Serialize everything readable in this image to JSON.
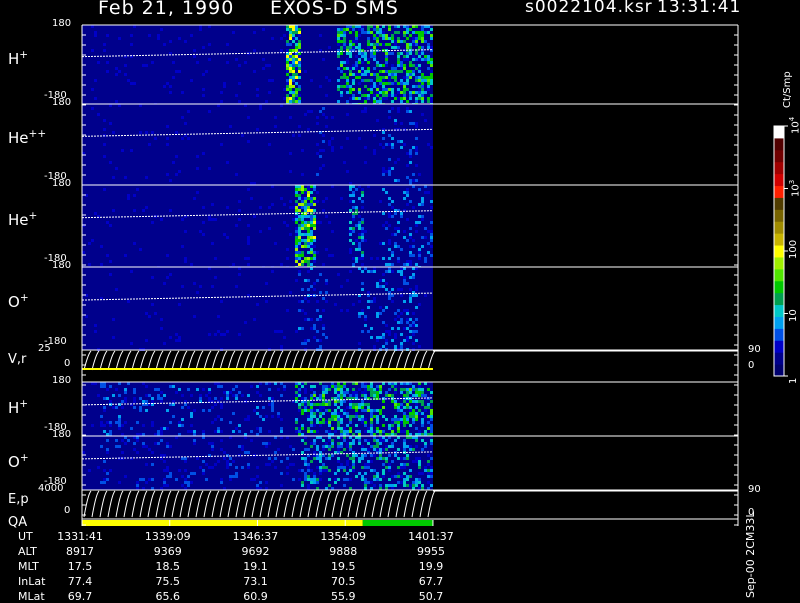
{
  "header": {
    "date": "Feb 21, 1990",
    "mission": "EXOS-D SMS",
    "file": "s0022104.ksr",
    "time": "13:31:41"
  },
  "colorbar": {
    "unit": "Ct/Smp",
    "ticks": [
      {
        "label": "1",
        "value": 1
      },
      {
        "label": "10",
        "value": 10
      },
      {
        "label": "100",
        "value": 100
      },
      {
        "label": "10",
        "sup": "3",
        "value": 1000
      },
      {
        "label": "10",
        "sup": "4",
        "value": 10000
      }
    ],
    "colors": [
      "#00006e",
      "#00008c",
      "#0000c8",
      "#0050e6",
      "#00a0f0",
      "#00c8c8",
      "#00a050",
      "#00c800",
      "#50e600",
      "#a0f000",
      "#ffff00",
      "#c8b400",
      "#a08c00",
      "#786400",
      "#503c00",
      "#ff2000",
      "#d00000",
      "#a00000",
      "#700000",
      "#500000",
      "#ffffff"
    ]
  },
  "footer": {
    "right_label": "Sep-00 2CM33L",
    "table": [
      {
        "name": "UT",
        "values": [
          "1331:41",
          "1339:09",
          "1346:37",
          "1354:09",
          "1401:37"
        ]
      },
      {
        "name": "ALT",
        "values": [
          "8917",
          "9369",
          "9692",
          "9888",
          "9955"
        ]
      },
      {
        "name": "MLT",
        "values": [
          "17.5",
          "18.5",
          "19.1",
          "19.5",
          "19.9"
        ]
      },
      {
        "name": "InLat",
        "values": [
          "77.4",
          "75.5",
          "73.1",
          "70.5",
          "67.7"
        ]
      },
      {
        "name": "MLat",
        "values": [
          "69.7",
          "65.6",
          "60.9",
          "55.9",
          "50.7"
        ]
      }
    ]
  },
  "chart_data": {
    "type": "heatmap",
    "title": "Feb 21, 1990   EXOS-D SMS",
    "x_ticks": [
      "1331:41",
      "1339:09",
      "1346:37",
      "1354:09",
      "1401:37"
    ],
    "data_extent_fraction": 0.535,
    "panels": [
      {
        "label": "H",
        "sup": "+",
        "ymax": "180",
        "ymin": "-180",
        "type": "spectrogram",
        "activity": [
          {
            "from": 0.58,
            "to": 0.62,
            "level": 0.75
          },
          {
            "from": 0.72,
            "to": 1.0,
            "level": 0.55
          }
        ]
      },
      {
        "label": "He",
        "sup": "++",
        "ymax": "180",
        "ymin": "-180",
        "type": "spectrogram",
        "activity": [
          {
            "from": 0.66,
            "to": 0.69,
            "level": 0.2
          },
          {
            "from": 0.85,
            "to": 0.95,
            "level": 0.2
          }
        ]
      },
      {
        "label": "He",
        "sup": "+",
        "ymax": "180",
        "ymin": "-180",
        "type": "spectrogram",
        "activity": [
          {
            "from": 0.6,
            "to": 0.66,
            "level": 0.7
          },
          {
            "from": 0.76,
            "to": 0.8,
            "level": 0.4
          },
          {
            "from": 0.85,
            "to": 1.0,
            "level": 0.25
          }
        ]
      },
      {
        "label": "O",
        "sup": "+",
        "ymax": "180",
        "ymin": "-180",
        "type": "spectrogram",
        "activity": [
          {
            "from": 0.6,
            "to": 0.7,
            "level": 0.2
          },
          {
            "from": 0.78,
            "to": 0.95,
            "level": 0.25
          }
        ]
      },
      {
        "label": "V,r",
        "sup": "",
        "ymax": "25",
        "ymin": "0",
        "right_top": "90",
        "right_bottom": "0",
        "type": "line"
      },
      {
        "label": "H",
        "sup": "+",
        "ymax": "180",
        "ymin": "-180",
        "type": "spectrogram",
        "activity": [
          {
            "from": 0.05,
            "to": 0.58,
            "level": 0.2
          },
          {
            "from": 0.6,
            "to": 1.0,
            "level": 0.55
          }
        ]
      },
      {
        "label": "O",
        "sup": "+",
        "ymax": "180",
        "ymin": "-180",
        "type": "spectrogram",
        "activity": [
          {
            "from": 0.05,
            "to": 0.6,
            "level": 0.15
          },
          {
            "from": 0.62,
            "to": 1.0,
            "level": 0.4
          }
        ]
      },
      {
        "label": "E,p",
        "sup": "",
        "ymax": "4000",
        "ymin": "0",
        "right_top": "90",
        "right_bottom": "0",
        "type": "line"
      },
      {
        "label": "QA",
        "sup": "",
        "type": "quality",
        "segments": [
          {
            "to": 0.8,
            "color": "#ffff00"
          },
          {
            "to": 1.0,
            "color": "#00c800"
          }
        ]
      }
    ]
  }
}
